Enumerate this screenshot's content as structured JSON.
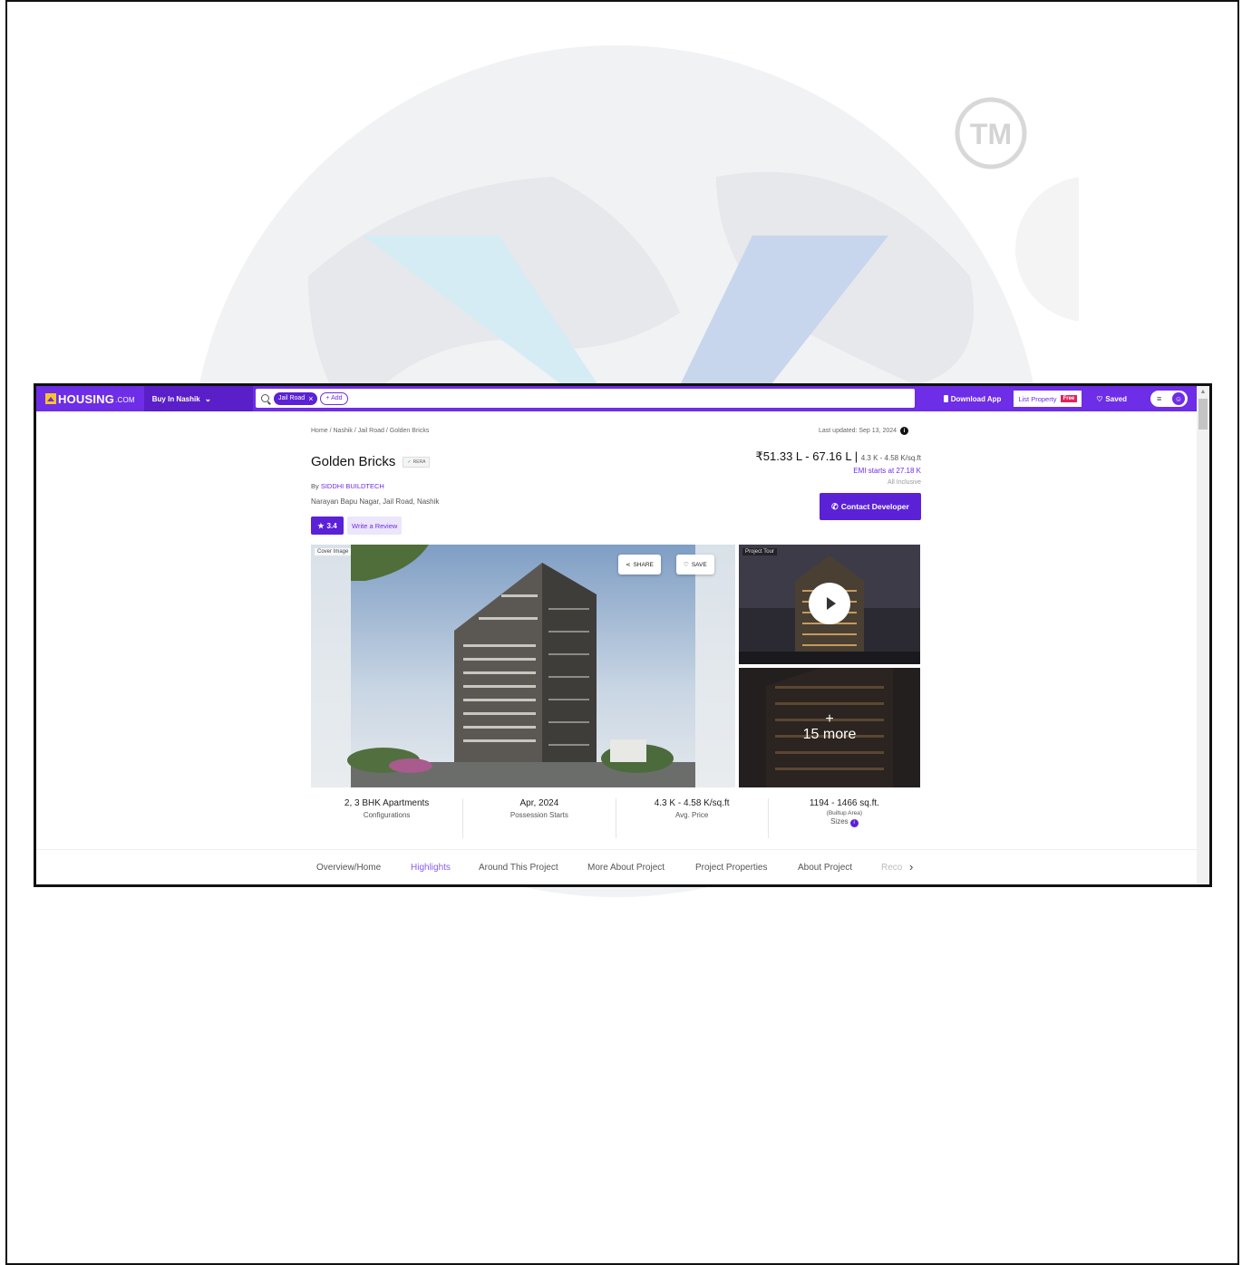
{
  "header": {
    "logo_text": "HOUSING",
    "logo_suffix": ".COM",
    "buy_dropdown": "Buy In Nashik",
    "search_chip": "Jail Road",
    "add_chip": "+ Add",
    "download_app": "Download App",
    "list_property": "List Property",
    "free_badge": "Free",
    "saved": "Saved"
  },
  "page": {
    "breadcrumb": "Home / Nashik / Jail Road / Golden Bricks",
    "last_updated": "Last updated: Sep 13, 2024",
    "project_title": "Golden Bricks",
    "rera_label": "RERA",
    "by_prefix": "By ",
    "developer": "SIDDHI BUILDTECH",
    "address": "Narayan Bapu Nagar, Jail Road, Nashik",
    "rating": "3.4",
    "write_review": "Write a Review",
    "price_range": "₹51.33 L - 67.16 L",
    "price_per_sqft": "4.3 K - 4.58 K/sq.ft",
    "emi": "EMI starts at  27.18 K",
    "inclusive": "All Inclusive",
    "contact_button": "Contact Developer"
  },
  "gallery": {
    "cover_label": "Cover Image",
    "share": "SHARE",
    "save": "SAVE",
    "tour_label": "Project Tour",
    "more_plus": "+",
    "more_count": "15 more"
  },
  "stats": [
    {
      "value": "2, 3 BHK Apartments",
      "label": "Configurations"
    },
    {
      "value": "Apr, 2024",
      "label": "Possession Starts"
    },
    {
      "value": "4.3 K - 4.58 K/sq.ft",
      "label": "Avg. Price"
    },
    {
      "value": "1194 - 1466 sq.ft.",
      "sub": "(Builtup Area)",
      "label": "Sizes"
    }
  ],
  "tabs": [
    {
      "label": "Overview/Home"
    },
    {
      "label": "Highlights",
      "active": true
    },
    {
      "label": "Around This Project"
    },
    {
      "label": "More About Project"
    },
    {
      "label": "Project Properties"
    },
    {
      "label": "About Project"
    },
    {
      "label": "Reco"
    }
  ],
  "watermark_text": "TM",
  "colors": {
    "brand": "#6e2de6",
    "brand_dark": "#5b21d6",
    "accent_yellow": "#f7c52b",
    "free_badge": "#e0245e"
  },
  "icons": [
    "search-icon",
    "close-icon",
    "phone-icon",
    "heart-icon",
    "menu-icon",
    "avatar-icon",
    "info-icon",
    "star-icon",
    "share-icon",
    "play-icon",
    "chevron-right-icon"
  ]
}
